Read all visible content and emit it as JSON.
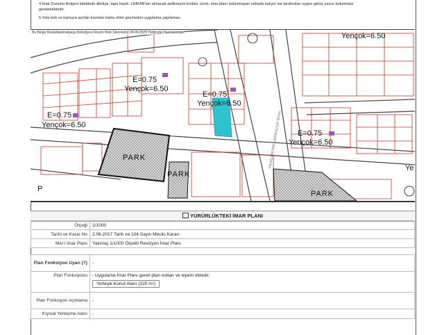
{
  "notes": [
    "4.İmar Durumu Belgesi talebinde dilekçe, tapu kaydı, LİHKAB'tan alınacak aplikasyon krokisi, ücret, imar planı bulunmayan sahada kalıyor ise tarafından uygun görüş yazısı bulunması",
    "gerekmektedir.",
    "5.Yola terk ve kamuya ayrılan kısımlar kamu eline geçmeden uygulama yapılamaz."
  ],
  "map": {
    "caption": "Bu Belge Mustafakemalpaşa Belediyesi Resmi Web Sitesinden 24.06.2025 Tarihinde Hazırlanmıştır",
    "zones": [
      {
        "e": "E=0.75",
        "h": "Yençok=6.50"
      },
      {
        "e": "E=0.75",
        "h": "Yençok=6.50"
      },
      {
        "e": "E=0.75",
        "h": "Yençok=6.50"
      },
      {
        "e": "E=0.75",
        "h": "Yençok=6.50"
      },
      {
        "e": "",
        "h": "Yençok=6.50"
      }
    ],
    "park_labels": [
      "PARK",
      "PARK",
      "PARK"
    ],
    "edge_letters": [
      "P",
      "Ye"
    ],
    "road_text": "YALNIZ ATATÜRK CADDESİ (ÇAY BOYU)"
  },
  "section": {
    "title": "YÜRÜRLÜKTEKİ İMAR PLANI"
  },
  "rows": [
    {
      "label": "Ölçeği",
      "value": "1/1000"
    },
    {
      "label": "Tarihi ve Karar No",
      "value": "2.06.2017 Tarih ve 104 Sayılı Meclis Kararı"
    },
    {
      "label": "Mer'i İmar Planı",
      "value": "Yalıntaş 1/1000 Ölçekli Revizyon İmar Planı"
    }
  ],
  "plan": {
    "uyari_label": "Plan Fonksiyon Uyarı (?)",
    "uyari_value": "-",
    "fonksiyon_label": "Plan Fonksiyonu",
    "fonksiyon_value": "- Uygulama İmar Planı genel plan notları ve lejantı ektedir.",
    "unit": "Yerleşik Konut Alanı (325 m²)",
    "aciklama_label": "Plan Fonksiyon Açıklama",
    "aciklama_value": "-",
    "kiyi_label": "Kıyısal Yerleşme Alanı",
    "kiyi_value": "-"
  },
  "colors": {
    "parcel_line": "#c0392b",
    "road_line": "#444444",
    "highlight": "#2ec4cf",
    "park_fill": "#bdbdbd",
    "flag": "#9b59b6"
  }
}
